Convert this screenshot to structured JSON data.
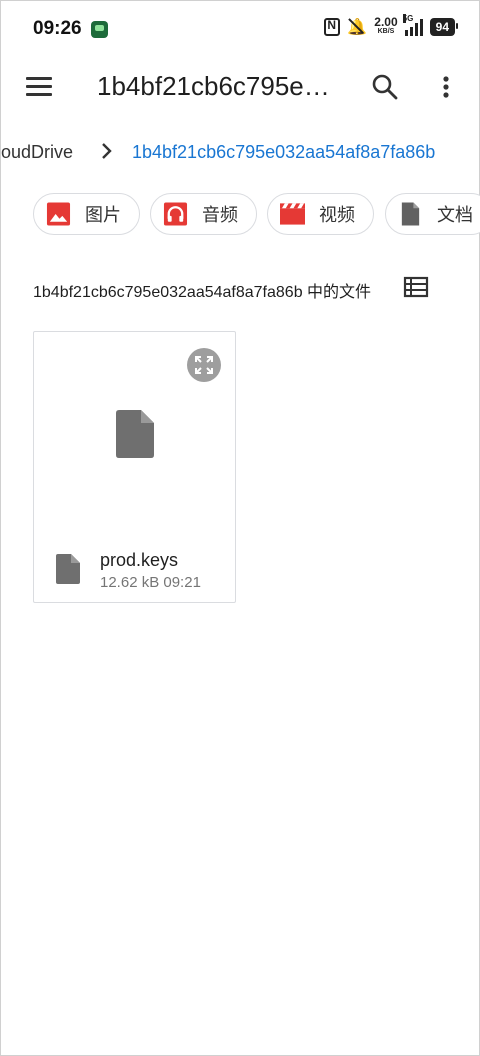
{
  "status_bar": {
    "time": "09:26",
    "net_speed_value": "2.00",
    "net_speed_unit": "KB/S",
    "network_type": "5G",
    "battery": "94"
  },
  "app_bar": {
    "title": "1b4bf21cb6c795e…"
  },
  "breadcrumb": {
    "parent": "oudDrive",
    "current": "1b4bf21cb6c795e032aa54af8a7fa86b"
  },
  "chips": [
    {
      "label": "图片",
      "icon": "image-icon",
      "color": "#e53935"
    },
    {
      "label": "音频",
      "icon": "headphones-icon",
      "color": "#e53935"
    },
    {
      "label": "视频",
      "icon": "clapperboard-icon",
      "color": "#e53935"
    },
    {
      "label": "文档",
      "icon": "document-icon",
      "color": "#616161"
    }
  ],
  "section": {
    "title": "1b4bf21cb6c795e032aa54af8a7fa86b 中的文件"
  },
  "files": [
    {
      "name": "prod.keys",
      "size": "12.62 kB",
      "time": "09:21",
      "meta": "12.62 kB 09:21"
    }
  ],
  "colors": {
    "accent": "#1976d2",
    "chip_red": "#e53935",
    "icon_gray": "#6f6f6f"
  }
}
